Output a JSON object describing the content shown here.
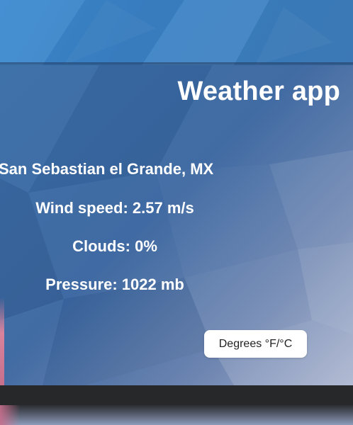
{
  "app": {
    "title": "Weather app"
  },
  "weather": {
    "location": "San Sebastian el Grande, MX",
    "wind_speed": "Wind speed: 2.57 m/s",
    "clouds": "Clouds: 0%",
    "pressure": "Pressure: 1022 mb"
  },
  "controls": {
    "units_toggle_label": "Degrees °F/°C"
  },
  "colors": {
    "panel_blue": "#3a6ea8",
    "top_blue": "#3b82c6",
    "text": "#ffffff",
    "button_bg": "#ffffff",
    "bottom_bar": "#262829"
  }
}
